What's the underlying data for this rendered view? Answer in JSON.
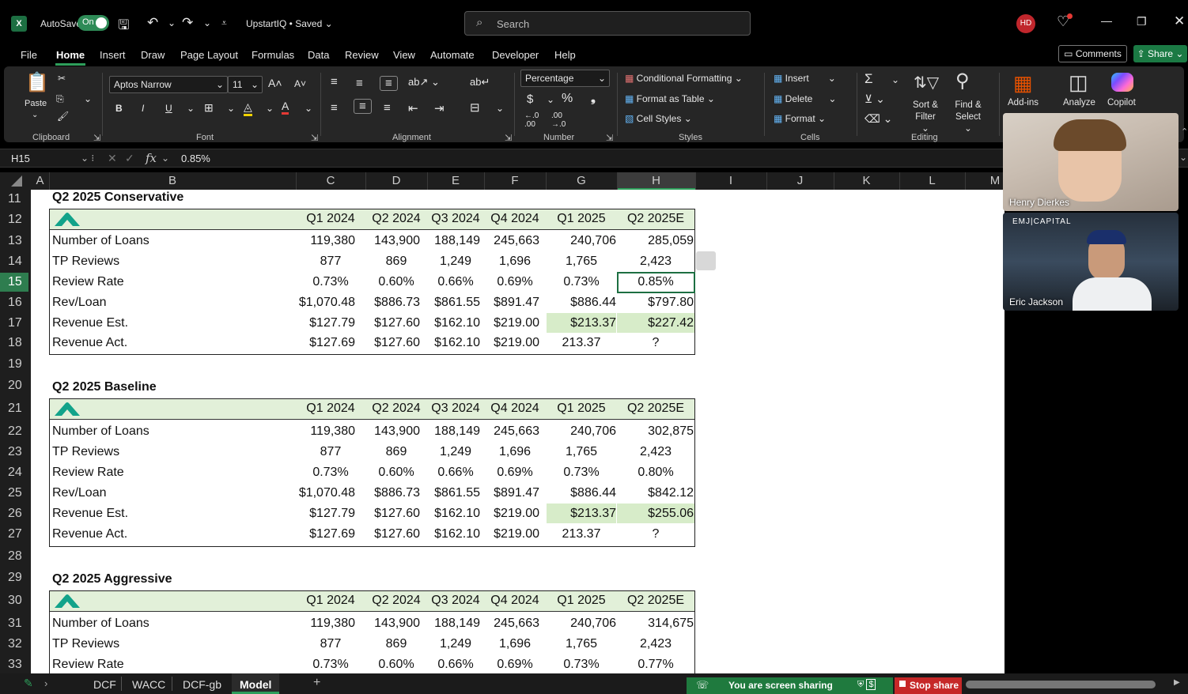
{
  "titlebar": {
    "autosave_label": "AutoSave",
    "autosave_state": "On",
    "doc_title": "UpstartIQ • Saved ⌄",
    "search_placeholder": "Search",
    "user_initials": "HD"
  },
  "menu": {
    "items": [
      "File",
      "Home",
      "Insert",
      "Draw",
      "Page Layout",
      "Formulas",
      "Data",
      "Review",
      "View",
      "Automate",
      "Developer",
      "Help"
    ],
    "comments_label": "Comments",
    "share_label": "Share"
  },
  "ribbon": {
    "paste_label": "Paste",
    "clipboard_group": "Clipboard",
    "font_name": "Aptos Narrow",
    "font_size": "11",
    "font_group": "Font",
    "alignment_group": "Alignment",
    "number_format": "Percentage",
    "number_group": "Number",
    "conditional_formatting": "Conditional Formatting ⌄",
    "format_as_table": "Format as Table ⌄",
    "cell_styles": "Cell Styles ⌄",
    "styles_group": "Styles",
    "insert_label": "Insert",
    "delete_label": "Delete",
    "format_label": "Format ⌄",
    "cells_group": "Cells",
    "sort_filter": "Sort & Filter ⌄",
    "find_select": "Find & Select ⌄",
    "editing_group": "Editing",
    "addins_label": "Add-ins",
    "analyze_label": "Analyze",
    "copilot_label": "Copilot"
  },
  "formula_bar": {
    "cell_ref": "H15",
    "value": "0.85%"
  },
  "columns": [
    "A",
    "B",
    "C",
    "D",
    "E",
    "F",
    "G",
    "H",
    "I",
    "J",
    "K",
    "L",
    "M"
  ],
  "row_numbers": [
    "11",
    "12",
    "13",
    "14",
    "15",
    "16",
    "17",
    "18",
    "19",
    "20",
    "21",
    "22",
    "23",
    "24",
    "25",
    "26",
    "27",
    "28",
    "29",
    "30",
    "31",
    "32",
    "33"
  ],
  "tables": [
    {
      "title": "Q2 2025 Conservative",
      "headers": [
        "Q1 2024",
        "Q2 2024",
        "Q3 2024",
        "Q4 2024",
        "Q1 2025",
        "Q2 2025E"
      ],
      "rows": [
        {
          "label": "Number of Loans",
          "values": [
            "119,380",
            "143,900",
            "188,149",
            "245,663",
            "240,706",
            "285,059"
          ]
        },
        {
          "label": "TP Reviews",
          "values": [
            "877",
            "869",
            "1,249",
            "1,696",
            "1,765",
            "2,423"
          ]
        },
        {
          "label": "Review Rate",
          "values": [
            "0.73%",
            "0.60%",
            "0.66%",
            "0.69%",
            "0.73%",
            "0.85%"
          ]
        },
        {
          "label": "Rev/Loan",
          "values": [
            "$1,070.48",
            "$886.73",
            "$861.55",
            "$891.47",
            "$886.44",
            "$797.80"
          ]
        },
        {
          "label": "Revenue Est.",
          "values": [
            "$127.79",
            "$127.60",
            "$162.10",
            "$219.00",
            "$213.37",
            "$227.42"
          ]
        },
        {
          "label": "Revenue Act.",
          "values": [
            "$127.69",
            "$127.60",
            "$162.10",
            "$219.00",
            "213.37",
            "?"
          ]
        }
      ]
    },
    {
      "title": "Q2 2025 Baseline",
      "headers": [
        "Q1 2024",
        "Q2 2024",
        "Q3 2024",
        "Q4 2024",
        "Q1 2025",
        "Q2 2025E"
      ],
      "rows": [
        {
          "label": "Number of Loans",
          "values": [
            "119,380",
            "143,900",
            "188,149",
            "245,663",
            "240,706",
            "302,875"
          ]
        },
        {
          "label": "TP Reviews",
          "values": [
            "877",
            "869",
            "1,249",
            "1,696",
            "1,765",
            "2,423"
          ]
        },
        {
          "label": "Review Rate",
          "values": [
            "0.73%",
            "0.60%",
            "0.66%",
            "0.69%",
            "0.73%",
            "0.80%"
          ]
        },
        {
          "label": "Rev/Loan",
          "values": [
            "$1,070.48",
            "$886.73",
            "$861.55",
            "$891.47",
            "$886.44",
            "$842.12"
          ]
        },
        {
          "label": "Revenue Est.",
          "values": [
            "$127.79",
            "$127.60",
            "$162.10",
            "$219.00",
            "$213.37",
            "$255.06"
          ]
        },
        {
          "label": "Revenue Act.",
          "values": [
            "$127.69",
            "$127.60",
            "$162.10",
            "$219.00",
            "213.37",
            "?"
          ]
        }
      ]
    },
    {
      "title": "Q2 2025 Aggressive",
      "headers": [
        "Q1 2024",
        "Q2 2024",
        "Q3 2024",
        "Q4 2024",
        "Q1 2025",
        "Q2 2025E"
      ],
      "rows": [
        {
          "label": "Number of Loans",
          "values": [
            "119,380",
            "143,900",
            "188,149",
            "245,663",
            "240,706",
            "314,675"
          ]
        },
        {
          "label": "TP Reviews",
          "values": [
            "877",
            "869",
            "1,249",
            "1,696",
            "1,765",
            "2,423"
          ]
        },
        {
          "label": "Review Rate",
          "values": [
            "0.73%",
            "0.60%",
            "0.66%",
            "0.69%",
            "0.73%",
            "0.77%"
          ]
        }
      ]
    }
  ],
  "video_tiles": [
    {
      "name": "Henry Dierkes"
    },
    {
      "name": "Eric Jackson",
      "overlay": "EMJ|CAPITAL"
    }
  ],
  "sheet_tabs": [
    "DCF",
    "WACC",
    "DCF-gb",
    "Model"
  ],
  "active_sheet": "Model",
  "screen_share": {
    "status": "You are screen sharing",
    "stop_label": "Stop share"
  },
  "colors": {
    "accent_green": "#1d6f42",
    "header_band": "#e2f0d9",
    "highlight": "#d7ecc9",
    "stop_red": "#c62828"
  }
}
